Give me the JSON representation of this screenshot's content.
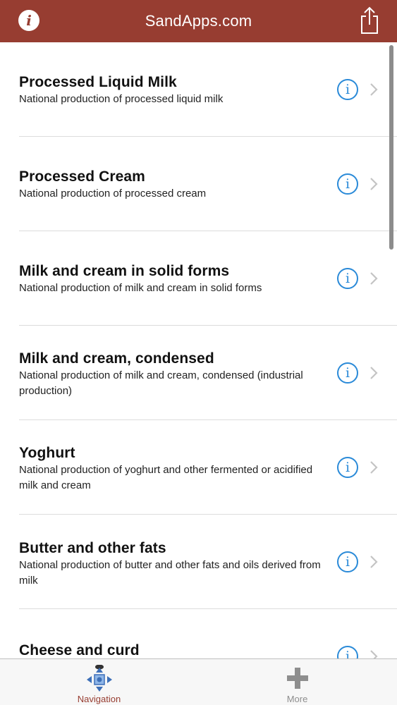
{
  "navbar": {
    "title": "SandApps.com",
    "info_icon_glyph": "i",
    "background": "#973d31"
  },
  "list": {
    "items": [
      {
        "title": "Processed Liquid Milk",
        "subtitle": "National production of processed liquid milk"
      },
      {
        "title": "Processed Cream",
        "subtitle": "National production of processed cream"
      },
      {
        "title": "Milk and cream in solid forms",
        "subtitle": "National production of milk and cream in solid forms"
      },
      {
        "title": "Milk and cream, condensed",
        "subtitle": "National production of milk and cream, condensed (industrial production)"
      },
      {
        "title": "Yoghurt",
        "subtitle": "National production of yoghurt and other fermented or acidified milk and cream"
      },
      {
        "title": "Butter and other fats",
        "subtitle": "National production of butter and other fats and oils derived from milk"
      },
      {
        "title": "Cheese and curd",
        "subtitle": ""
      }
    ],
    "info_glyph": "i",
    "info_color": "#2a8ad8"
  },
  "tabbar": {
    "tabs": [
      {
        "label": "Navigation",
        "icon": "navigation-arrows-icon",
        "active": true
      },
      {
        "label": "More",
        "icon": "plus-icon",
        "active": false
      }
    ],
    "active_color": "#973d31"
  }
}
